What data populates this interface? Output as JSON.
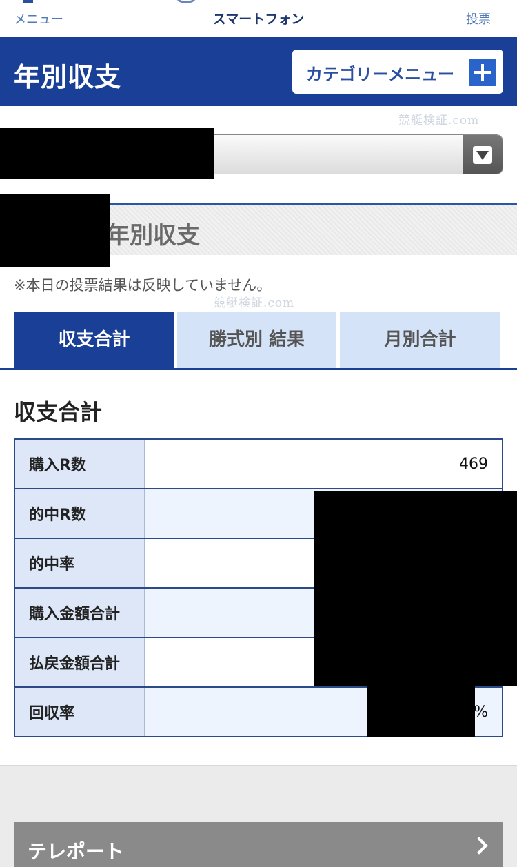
{
  "nav": {
    "menu_label": "メニュー",
    "title": "スマートフォン",
    "vote_label": "投票"
  },
  "header": {
    "title": "年別収支",
    "category_button": "カテゴリーメニュー"
  },
  "watermark": "競艇検証.com",
  "section": {
    "title": "年別収支",
    "note": "※本日の投票結果は反映していません。"
  },
  "tabs": [
    {
      "label": "収支合計",
      "active": true
    },
    {
      "label": "勝式別 結果",
      "active": false
    },
    {
      "label": "月別合計",
      "active": false
    }
  ],
  "summary": {
    "heading": "収支合計",
    "rows": [
      {
        "label": "購入R数",
        "value": "469"
      },
      {
        "label": "的中R数",
        "value": ""
      },
      {
        "label": "的中率",
        "value": ""
      },
      {
        "label": "購入金額合計",
        "value": ""
      },
      {
        "label": "払戻金額合計",
        "value": ""
      },
      {
        "label": "回収率",
        "value": "%"
      }
    ]
  },
  "footer": {
    "teleport_label": "テレポート"
  },
  "colors": {
    "primary": "#1a3f96",
    "tab_inactive": "#d5e3f8",
    "table_header": "#dde7f8",
    "footer_button": "#8a8a8a"
  }
}
